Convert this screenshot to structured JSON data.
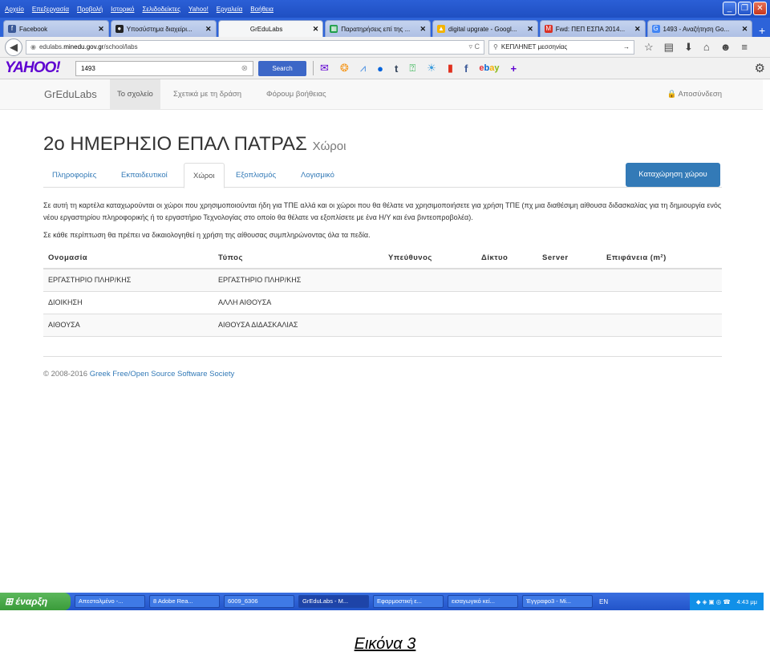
{
  "menubar": {
    "items": [
      "Αρχείο",
      "Επεξεργασία",
      "Προβολή",
      "Ιστορικό",
      "Σελιδοδείκτες",
      "Yahoo!",
      "Εργαλεία",
      "Βοήθεια"
    ]
  },
  "tabs": [
    {
      "label": "Facebook",
      "icon": "facebook-icon",
      "color": "#3b5998",
      "glyph": "f"
    },
    {
      "label": "Υποσύστημα διαχείρι...",
      "icon": "github-icon",
      "color": "#222222",
      "glyph": "●"
    },
    {
      "label": "GrEduLabs",
      "icon": "",
      "color": "",
      "glyph": ""
    },
    {
      "label": "Παρατηρήσεις επί της ...",
      "icon": "sheet-icon",
      "color": "#1e9e4a",
      "glyph": "▦"
    },
    {
      "label": "digital upgrate - Googl...",
      "icon": "drive-icon",
      "color": "#f4b400",
      "glyph": "▲"
    },
    {
      "label": "Fwd: ΠΕΠ ΕΣΠΑ 2014...",
      "icon": "mail-icon",
      "color": "#d93025",
      "glyph": "M"
    },
    {
      "label": "1493 - Αναζήτηση Go...",
      "icon": "google-icon",
      "color": "#4285f4",
      "glyph": "G"
    }
  ],
  "address": {
    "url_prefix": "edulabs.",
    "url_domain": "minedu.gov.gr",
    "url_path": "/school/labs",
    "search": "ΚΕΠΛΗΝΕΤ μεσσηνίας"
  },
  "yahoo": {
    "logo": "YAHOO!",
    "query": "1493",
    "button": "Search"
  },
  "site": {
    "brand": "GrEduLabs",
    "nav": [
      "Το σχολείο",
      "Σχετικά με τη δράση",
      "Φόρουμ βοήθειας"
    ],
    "logout": "🔒 Αποσύνδεση"
  },
  "page": {
    "title": "2ο ΗΜΕΡΗΣΙΟ ΕΠΑΛ ΠΑΤΡΑΣ",
    "subtitle": "Χώροι",
    "tabs": [
      "Πληροφορίες",
      "Εκπαιδευτικοί",
      "Χώροι",
      "Εξοπλισμός",
      "Λογισμικό"
    ],
    "add_button": "Καταχώρηση χώρου",
    "desc1": "Σε αυτή τη καρτέλα καταχωρούνται οι χώροι που χρησιμοποιούνται ήδη για ΤΠΕ αλλά και οι χώροι που θα θέλατε να χρησιμοποιήσετε για χρήση ΤΠΕ (πχ μια διαθέσιμη αίθουσα διδασκαλίας για τη δημιουργία ενός νέου εργαστηρίου πληροφορικής ή το εργαστήριο Τεχνολογίας στο οποίο θα θέλατε να εξοπλίσετε με ένα Η/Υ και ένα βιντεοπροβολέα).",
    "desc2": "Σε κάθε περίπτωση θα πρέπει να δικαιολογηθεί η χρήση της αίθουσας συμπληρώνοντας όλα τα πεδία.",
    "columns": [
      "Ονομασία",
      "Τύπος",
      "Υπεύθυνος",
      "Δίκτυο",
      "Server",
      "Επιφάνεια (m²)"
    ],
    "rows": [
      [
        "ΕΡΓΑΣΤΗΡΙΟ ΠΛΗΡ/ΚΗΣ",
        "ΕΡΓΑΣΤΗΡΙΟ ΠΛΗΡ/ΚΗΣ",
        "",
        "",
        "",
        ""
      ],
      [
        "ΔΙΟΙΚΗΣΗ",
        "ΑΛΛΗ ΑΙΘΟΥΣΑ",
        "",
        "",
        "",
        ""
      ],
      [
        "ΑΙΘΟΥΣΑ",
        "ΑΙΘΟΥΣΑ ΔΙΔΑΣΚΑΛΙΑΣ",
        "",
        "",
        "",
        ""
      ]
    ],
    "footer_prefix": "© 2008-2016",
    "footer_link": "Greek Free/Open Source Software Society"
  },
  "taskbar": {
    "start": "έναρξη",
    "tasks": [
      "Απεσταλμένο -...",
      "8 Adobe Rea...",
      "6009_6306",
      "GrEduLabs - M...",
      "Εφαρμοστική ε...",
      "εισαγωγικό κεί...",
      "Έγγραφο3 - Mi..."
    ],
    "lang": "EN",
    "clock": "4:43 μμ"
  },
  "caption": "Εικόνα 3"
}
